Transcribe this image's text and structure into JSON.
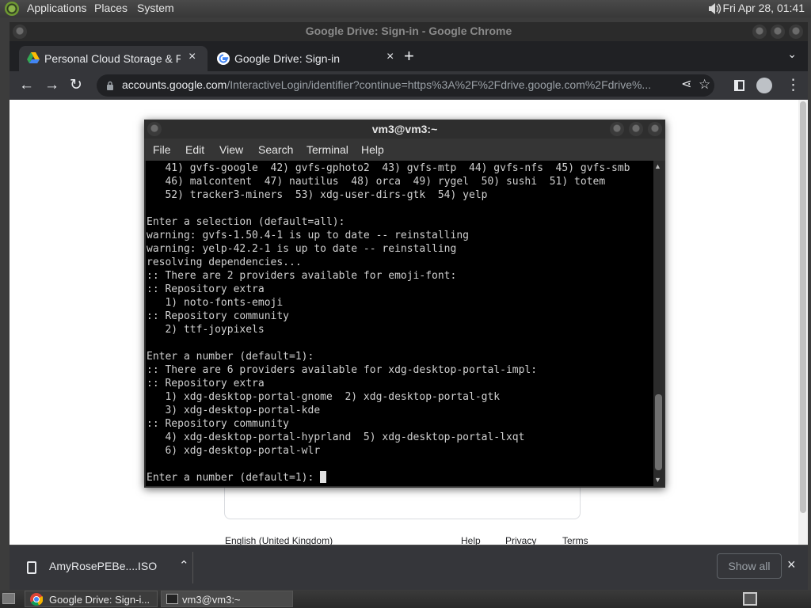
{
  "top_panel": {
    "menus": [
      "Applications",
      "Places",
      "System"
    ],
    "clock": "Fri Apr 28, 01:41"
  },
  "chrome": {
    "window_title": "Google Drive: Sign-in - Google Chrome",
    "tabs": [
      {
        "title": "Personal Cloud Storage & File",
        "close": "×"
      },
      {
        "title": "Google Drive: Sign-in",
        "close": "×"
      }
    ],
    "new_tab": "+",
    "tab_menu": "⌄",
    "url_host": "accounts.google.com",
    "url_path": "/InteractiveLogin/identifier?continue=https%3A%2F%2Fdrive.google.com%2Fdrive%...",
    "footer": {
      "language": "English (United Kingdom)",
      "help": "Help",
      "privacy": "Privacy",
      "terms": "Terms"
    },
    "download": {
      "filename": "AmyRosePEBe....ISO",
      "show_all": "Show all",
      "close": "×"
    }
  },
  "terminal": {
    "title": "vm3@vm3:~",
    "menus": [
      "File",
      "Edit",
      "View",
      "Search",
      "Terminal",
      "Help"
    ],
    "lines": [
      "   41) gvfs-google  42) gvfs-gphoto2  43) gvfs-mtp  44) gvfs-nfs  45) gvfs-smb",
      "   46) malcontent  47) nautilus  48) orca  49) rygel  50) sushi  51) totem",
      "   52) tracker3-miners  53) xdg-user-dirs-gtk  54) yelp",
      "",
      "Enter a selection (default=all):",
      "warning: gvfs-1.50.4-1 is up to date -- reinstalling",
      "warning: yelp-42.2-1 is up to date -- reinstalling",
      "resolving dependencies...",
      ":: There are 2 providers available for emoji-font:",
      ":: Repository extra",
      "   1) noto-fonts-emoji",
      ":: Repository community",
      "   2) ttf-joypixels",
      "",
      "Enter a number (default=1):",
      ":: There are 6 providers available for xdg-desktop-portal-impl:",
      ":: Repository extra",
      "   1) xdg-desktop-portal-gnome  2) xdg-desktop-portal-gtk",
      "   3) xdg-desktop-portal-kde",
      ":: Repository community",
      "   4) xdg-desktop-portal-hyprland  5) xdg-desktop-portal-lxqt",
      "   6) xdg-desktop-portal-wlr",
      "",
      "Enter a number (default=1): "
    ]
  },
  "taskbar": {
    "tasks": [
      "Google Drive: Sign-i...",
      "vm3@vm3:~"
    ]
  }
}
